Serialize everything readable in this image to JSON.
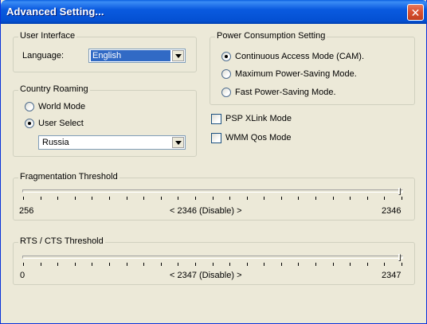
{
  "window": {
    "title": "Advanced Setting..."
  },
  "user_interface": {
    "legend": "User Interface",
    "language_label": "Language:",
    "language_value": "English"
  },
  "country_roaming": {
    "legend": "Country Roaming",
    "world_mode": "World Mode",
    "user_select": "User Select",
    "country_value": "Russia",
    "selected": "user_select"
  },
  "power": {
    "legend": "Power Consumption Setting",
    "cam": "Continuous Access Mode (CAM).",
    "max_psm": "Maximum Power-Saving Mode.",
    "fast_psm": "Fast Power-Saving Mode.",
    "selected": "cam"
  },
  "options": {
    "psp_xlink": "PSP XLink Mode",
    "wmm_qos": "WMM Qos Mode",
    "psp_checked": false,
    "wmm_checked": false
  },
  "fragmentation": {
    "legend": "Fragmentation Threshold",
    "min": "256",
    "max": "2346",
    "current": "< 2346 (Disable) >",
    "value": 2346,
    "min_value": 256,
    "max_value": 2346
  },
  "rts": {
    "legend": "RTS / CTS Threshold",
    "min": "0",
    "max": "2347",
    "current": "< 2347 (Disable) >",
    "value": 2347,
    "min_value": 0,
    "max_value": 2347
  }
}
